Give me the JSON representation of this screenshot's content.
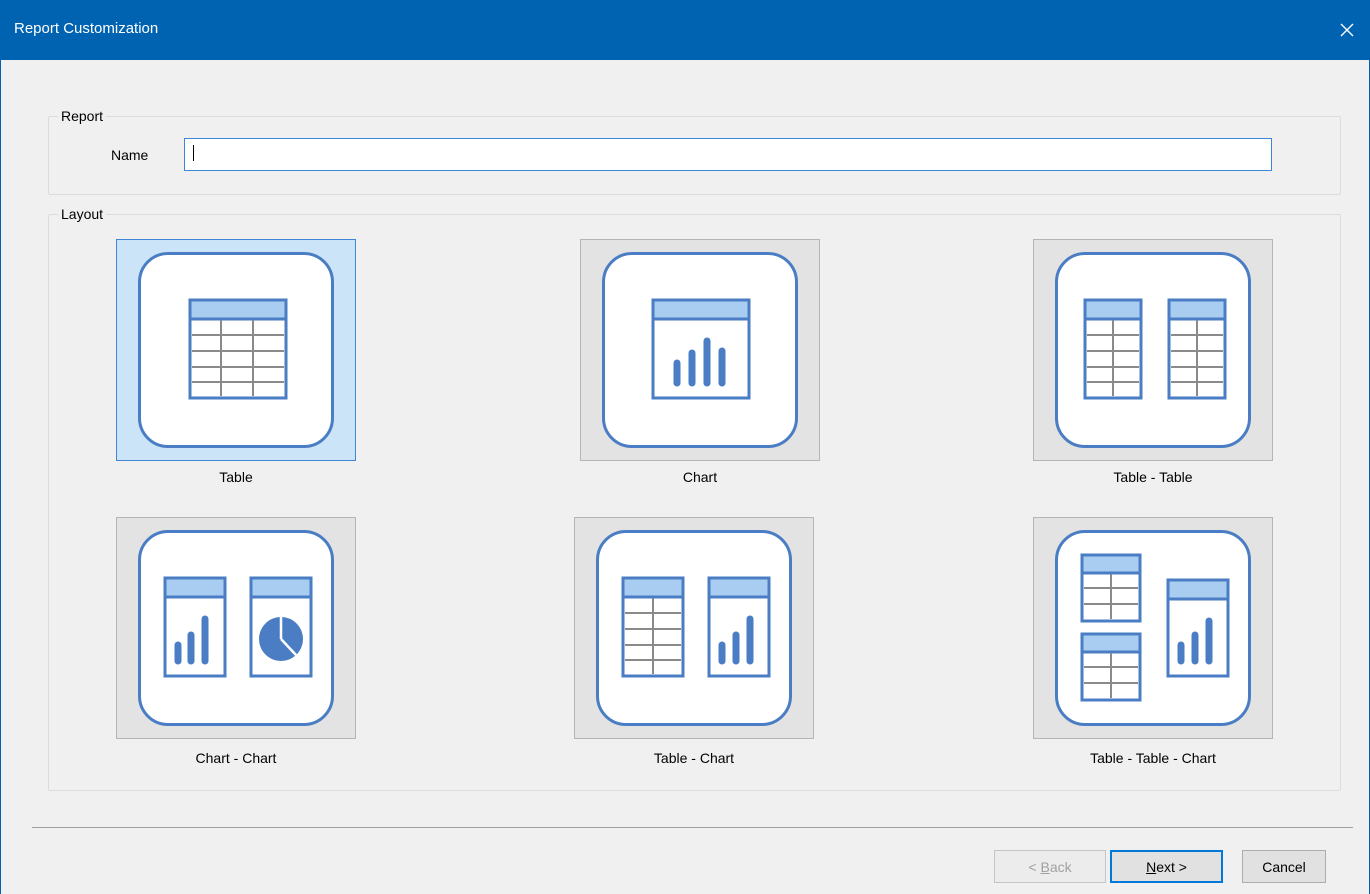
{
  "window": {
    "title": "Report Customization",
    "close_icon": "close-icon",
    "accent_color": "#0063b1"
  },
  "report_group": {
    "legend": "Report",
    "name_label": "Name",
    "name_value": ""
  },
  "layout_group": {
    "legend": "Layout",
    "selected": "Table",
    "options": [
      {
        "label": "Table",
        "icon": "table-layout-icon"
      },
      {
        "label": "Chart",
        "icon": "chart-layout-icon"
      },
      {
        "label": "Table - Table",
        "icon": "table-table-layout-icon"
      },
      {
        "label": "Chart - Chart",
        "icon": "chart-chart-layout-icon"
      },
      {
        "label": "Table - Chart",
        "icon": "table-chart-layout-icon"
      },
      {
        "label": "Table - Table - Chart",
        "icon": "table-table-chart-layout-icon"
      }
    ]
  },
  "buttons": {
    "back": {
      "prefix": "< ",
      "accel": "B",
      "rest": "ack",
      "enabled": false
    },
    "next": {
      "accel": "N",
      "rest": "ext >",
      "enabled": true
    },
    "cancel": {
      "label": "Cancel",
      "enabled": true
    }
  }
}
